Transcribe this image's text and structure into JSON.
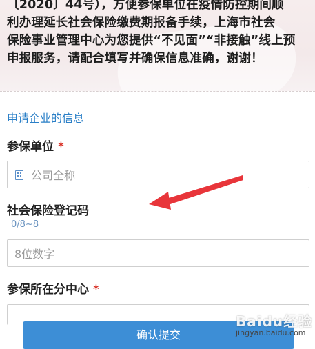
{
  "intro": {
    "lines": [
      "〔2020〕44号），方便参保单位在疫情防控期间顺",
      "利办理延长社会保险缴费期报备手续，上海市社会",
      "保险事业管理中心为您提供“不见面”“非接触”线上预",
      "申报服务，请配合填写并确保信息准确，谢谢！"
    ]
  },
  "form": {
    "section_title": "申请企业的信息",
    "required_mark": "*",
    "unit": {
      "label": "参保单位",
      "placeholder": "公司全称",
      "icon": "building-icon"
    },
    "reg_code": {
      "label": "社会保险登记码",
      "hint": "0/8~8",
      "placeholder": "8位数字"
    },
    "center": {
      "label": "参保所在分中心"
    },
    "submit_label": "确认提交"
  },
  "watermark": {
    "main": "Baidu经验",
    "sub": "jingyan.baidu.com"
  },
  "colors": {
    "accent": "#2a7fc7",
    "button": "#3d8ed6",
    "required": "#d9342a",
    "arrow": "#e8353a"
  }
}
